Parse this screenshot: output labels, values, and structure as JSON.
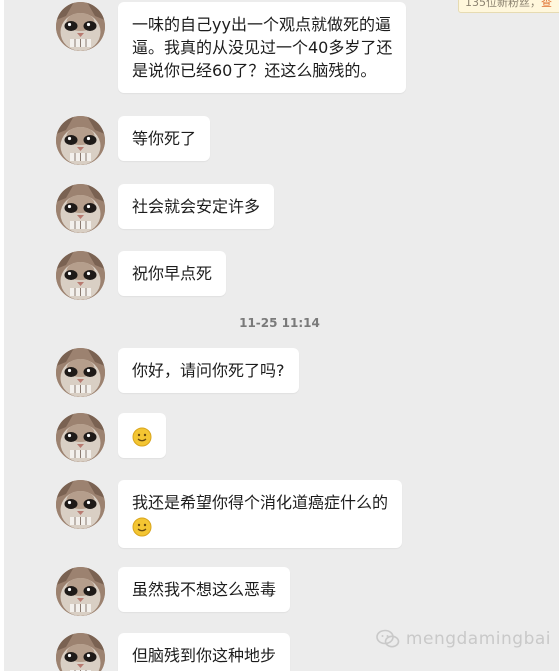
{
  "notification": {
    "text": "135位新粉丝，",
    "accent": "查"
  },
  "messages": [
    {
      "lines": [
        "一味的自己yy出一个观点就做死的逼",
        "逼。我真的从没见过一个40多岁了还",
        "是说你已经60了？还这么脑残的。"
      ]
    },
    {
      "lines": [
        "等你死了"
      ]
    },
    {
      "lines": [
        "社会就会安定许多"
      ]
    },
    {
      "lines": [
        "祝你早点死"
      ]
    },
    {
      "lines": [
        "你好，请问你死了吗?"
      ]
    },
    {
      "lines": []
    },
    {
      "lines": [
        "我还是希望你得个消化道癌症什么的"
      ]
    },
    {
      "lines": [
        "虽然我不想这么恶毒"
      ]
    },
    {
      "lines": [
        "但脑残到你这种地步"
      ]
    }
  ],
  "timestamp": "11-25 11:14",
  "watermark": {
    "text": "mengdamingbai",
    "icon": "wechat-icon"
  },
  "icons": {
    "emoji": "smile-emoji-icon",
    "avatar": "cat-avatar"
  },
  "colors": {
    "background": "#ececec",
    "bubble": "#ffffff",
    "emoji": "#f3c532"
  }
}
